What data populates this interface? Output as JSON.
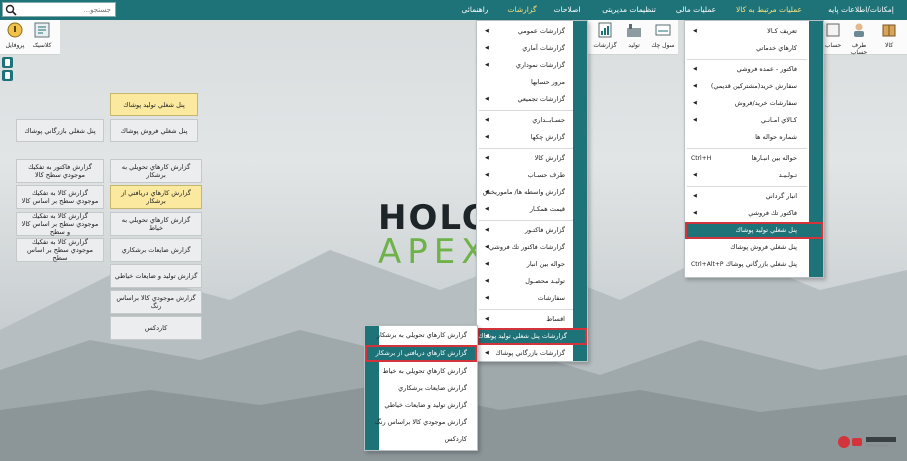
{
  "menubar": {
    "items": [
      {
        "label": "إمكانات/اطلاعات پایه",
        "active": false
      },
      {
        "label": "عملیات مرتبط به کالا",
        "active": true
      },
      {
        "label": "عملیات مالی",
        "active": false
      },
      {
        "label": "تنظیمات مدیریتی",
        "active": false
      },
      {
        "label": "اصلاحات",
        "active": false
      },
      {
        "label": "گزارشات",
        "active": true
      },
      {
        "label": "راهنمائی",
        "active": false
      }
    ],
    "search_placeholder": "جستجو..."
  },
  "toolbar_left": [
    {
      "label": "پروفایل",
      "icon": "profile-icon"
    },
    {
      "label": "کلاسیک",
      "icon": "classic-icon"
    }
  ],
  "toolbar_right": [
    {
      "label": "کالا",
      "icon": "goods-icon"
    },
    {
      "label": "طرف حساب",
      "icon": "account-party-icon"
    },
    {
      "label": "حساب",
      "icon": "account-icon"
    }
  ],
  "toolbar_mid": [
    {
      "label": "سول چك",
      "icon": "cheque-icon"
    },
    {
      "label": "تولید",
      "icon": "production-icon"
    },
    {
      "label": "گزارشات",
      "icon": "reports-icon"
    }
  ],
  "panel": {
    "col_mid": [
      {
        "label": "پنل شغلي توليد پوشاك",
        "highlight": true
      },
      {
        "label": "پنل شغلي فروش پوشاك",
        "highlight": false
      }
    ],
    "col_left_top": {
      "label": "پنل شغلي بازرگاني پوشاك"
    },
    "col_left": [
      "گزارش فاكتور به تفكيك موجودي سطح كالا",
      "گزارش كالا به تفكيك موجودي سطح بر اساس كالا",
      "گزارش كالا به تفكيك موجودي سطح بر اساس كالا و سطح",
      "گزارش كالا به تفكيك موجودي سطح بر اساس سطح"
    ],
    "col_mid_reports": [
      {
        "label": "گزارش كارهاي تحويلي به برشكار",
        "highlight": false
      },
      {
        "label": "گزارش كارهاي دريافتي از برشكار",
        "highlight": true
      },
      {
        "label": "گزارش كارهاي تحويلي به خياط",
        "highlight": false
      },
      {
        "label": "گزارش ضايعات برشكاري",
        "highlight": false
      },
      {
        "label": "گزارش توليد و ضايعات خياطي",
        "highlight": false
      },
      {
        "label": "گزارش موجودي كالا براساس رنگ",
        "highlight": false
      },
      {
        "label": "كاردكس",
        "highlight": false
      }
    ]
  },
  "logo": {
    "line1": "HOLOO",
    "line2": "APEX"
  },
  "menu_goods": {
    "items": [
      {
        "label": "تعريف كـالا",
        "arrow": true,
        "shortcut": ""
      },
      {
        "label": "كارهاي خدماتي",
        "arrow": false,
        "shortcut": ""
      },
      {
        "label": "فاكتور - عمده فروشي",
        "arrow": true,
        "shortcut": ""
      },
      {
        "label": "سفارش خريد(مشتركين قديمي)",
        "arrow": true,
        "shortcut": ""
      },
      {
        "label": "سفارشات خريد/فروش",
        "arrow": true,
        "shortcut": ""
      },
      {
        "label": "كـالاي امـانـي",
        "arrow": true,
        "shortcut": ""
      },
      {
        "label": "شماره حواله ها",
        "arrow": false,
        "shortcut": ""
      },
      {
        "label": "حواله بين انبـارها",
        "arrow": false,
        "shortcut": "Ctrl+H"
      },
      {
        "label": "تـولـيـد",
        "arrow": true,
        "shortcut": ""
      },
      {
        "label": "انبار گرداني",
        "arrow": true,
        "shortcut": ""
      },
      {
        "label": "فاكتور تك فروشي",
        "arrow": true,
        "shortcut": ""
      },
      {
        "label": "پنل شغلي توليد پوشاك",
        "arrow": false,
        "shortcut": "",
        "selected": true
      },
      {
        "label": "پنل شغلي فروش پوشاك",
        "arrow": false,
        "shortcut": ""
      },
      {
        "label": "پنل شغلي بازرگاني پوشاك",
        "arrow": false,
        "shortcut": "Ctrl+Alt+P"
      }
    ]
  },
  "menu_reports": {
    "items": [
      {
        "label": "گزارشات عمومي",
        "arrow": true
      },
      {
        "label": "گزارشات آماري",
        "arrow": true
      },
      {
        "label": "گزارشات نموداري",
        "arrow": true
      },
      {
        "label": "مرور حسابها",
        "arrow": false
      },
      {
        "label": "گزارشات تجميعي",
        "arrow": true
      },
      {
        "label": "حسـابــداري",
        "arrow": true
      },
      {
        "label": "گزارش چكها",
        "arrow": true
      },
      {
        "label": "گزارش كالا",
        "arrow": true
      },
      {
        "label": "طرف حسـاب",
        "arrow": true
      },
      {
        "label": "گزارش واسطه ها/ ماموريخش",
        "arrow": true
      },
      {
        "label": "قيمت همكـار",
        "arrow": true
      },
      {
        "label": "گزارش فاكتـور",
        "arrow": true
      },
      {
        "label": "گزارشات فاكتور تك فروشي",
        "arrow": true
      },
      {
        "label": "حواله بين انبار",
        "arrow": true
      },
      {
        "label": "توليـد محصـول",
        "arrow": true
      },
      {
        "label": "سفارشات",
        "arrow": true
      },
      {
        "label": "اقساط",
        "arrow": true
      },
      {
        "label": "گزارشات پنل شغلي توليد پوشاك",
        "arrow": true,
        "selected": true
      },
      {
        "label": "گزارشات بازرگاني پوشاك",
        "arrow": true
      }
    ]
  },
  "menu_sub": {
    "items": [
      {
        "label": "گزارش كارهاي تحويلي به برشكار"
      },
      {
        "label": "گزارش كارهاي دريافتي از برشكار",
        "selected": true
      },
      {
        "label": "گزارش كارهاي تحويلي به خياط"
      },
      {
        "label": "گزارش ضايعات برشكاري"
      },
      {
        "label": "گزارش توليد و ضايعات خياطي"
      },
      {
        "label": "گزارش موجودي كالا براساس رنگ"
      },
      {
        "label": "كاردكس"
      }
    ]
  },
  "colors": {
    "accent": "#1e7378",
    "highlight": "#fbe9a0",
    "selection_border": "#d3343b",
    "apex_green": "#6fb24a"
  }
}
